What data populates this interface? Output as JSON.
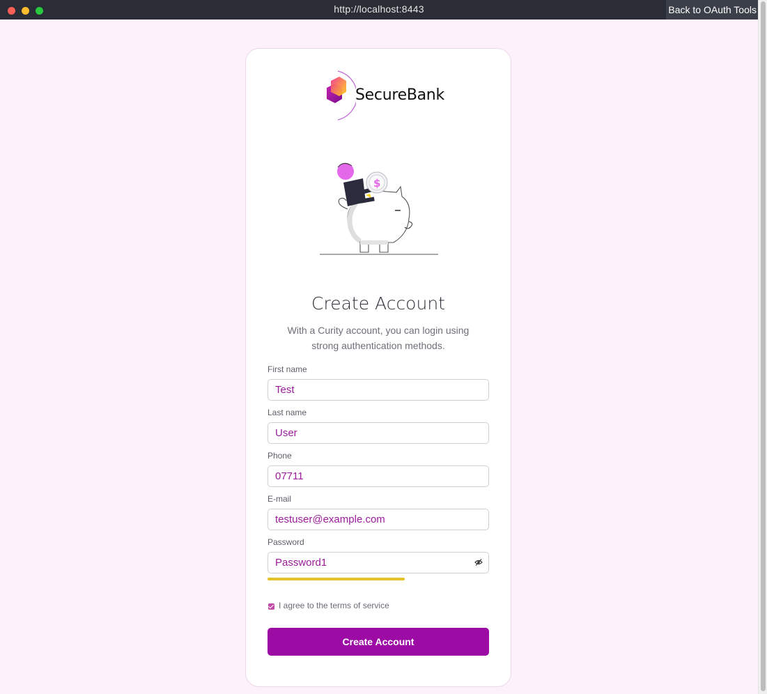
{
  "browser": {
    "url": "http://localhost:8443",
    "back_button": "Back to OAuth Tools"
  },
  "brand": {
    "name": "SecureBank",
    "primary_color": "#9c0ca5",
    "input_text_color": "#9b1c9b"
  },
  "page": {
    "title": "Create Account",
    "subtitle": "With a Curity account, you can login using strong authentication methods."
  },
  "form": {
    "first_name": {
      "label": "First name",
      "value": "Test"
    },
    "last_name": {
      "label": "Last name",
      "value": "User"
    },
    "phone": {
      "label": "Phone",
      "value": "07711"
    },
    "email": {
      "label": "E-mail",
      "value": "testuser@example.com"
    },
    "password": {
      "label": "Password",
      "value": "Password1",
      "toggle_icon": "eye-slash-icon"
    },
    "password_strength": {
      "level_fraction": 0.62,
      "color": "#e5c12a"
    },
    "terms": {
      "label": "I agree to the terms of service",
      "checked": true
    },
    "submit_label": "Create Account"
  }
}
